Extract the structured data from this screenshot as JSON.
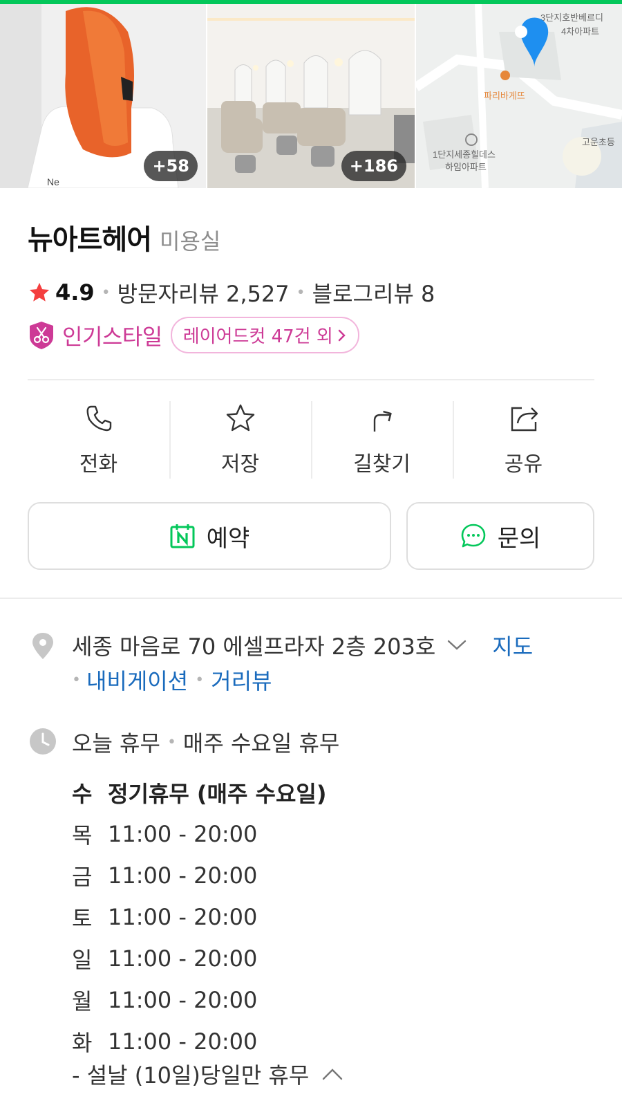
{
  "photos": [
    {
      "count": "+58"
    },
    {
      "count": "+186"
    }
  ],
  "map": {
    "labels": [
      "3단지호반베르디",
      "4차아파트",
      "파리바게뜨",
      "1단지세종힐데스",
      "하임아파트",
      "고운초등"
    ]
  },
  "place": {
    "name": "뉴아트헤어",
    "category": "미용실",
    "rating": "4.9",
    "visitor_reviews": "방문자리뷰 2,527",
    "blog_reviews": "블로그리뷰 8",
    "popular_style_label": "인기스타일",
    "popular_style_chip": "레이어드컷 47건 외"
  },
  "actions": [
    {
      "label": "전화",
      "icon": "phone-icon"
    },
    {
      "label": "저장",
      "icon": "star-outline-icon"
    },
    {
      "label": "길찾기",
      "icon": "directions-icon"
    },
    {
      "label": "공유",
      "icon": "share-icon"
    }
  ],
  "buttons": {
    "reserve": "예약",
    "inquiry": "문의"
  },
  "address": {
    "text": "세종 마음로 70 에셀프라자 2층 203호",
    "map_link": "지도",
    "navigation_link": "내비게이션",
    "street_view_link": "거리뷰"
  },
  "hours": {
    "today_status": "오늘 휴무",
    "today_note": "매주 수요일 휴무",
    "schedule": [
      {
        "day": "수",
        "time": "정기휴무 (매주 수요일)"
      },
      {
        "day": "목",
        "time": "11:00 - 20:00"
      },
      {
        "day": "금",
        "time": "11:00 - 20:00"
      },
      {
        "day": "토",
        "time": "11:00 - 20:00"
      },
      {
        "day": "일",
        "time": "11:00 - 20:00"
      },
      {
        "day": "월",
        "time": "11:00 - 20:00"
      },
      {
        "day": "화",
        "time": "11:00 - 20:00"
      }
    ],
    "holiday_note": "- 설날 (10일)당일만 휴무"
  },
  "colors": {
    "naver_green": "#03c75a",
    "rating_star": "#f43f3f",
    "style_pink": "#cd3a96",
    "link_blue": "#1a6bbd",
    "map_pin": "#1e8ff0"
  }
}
